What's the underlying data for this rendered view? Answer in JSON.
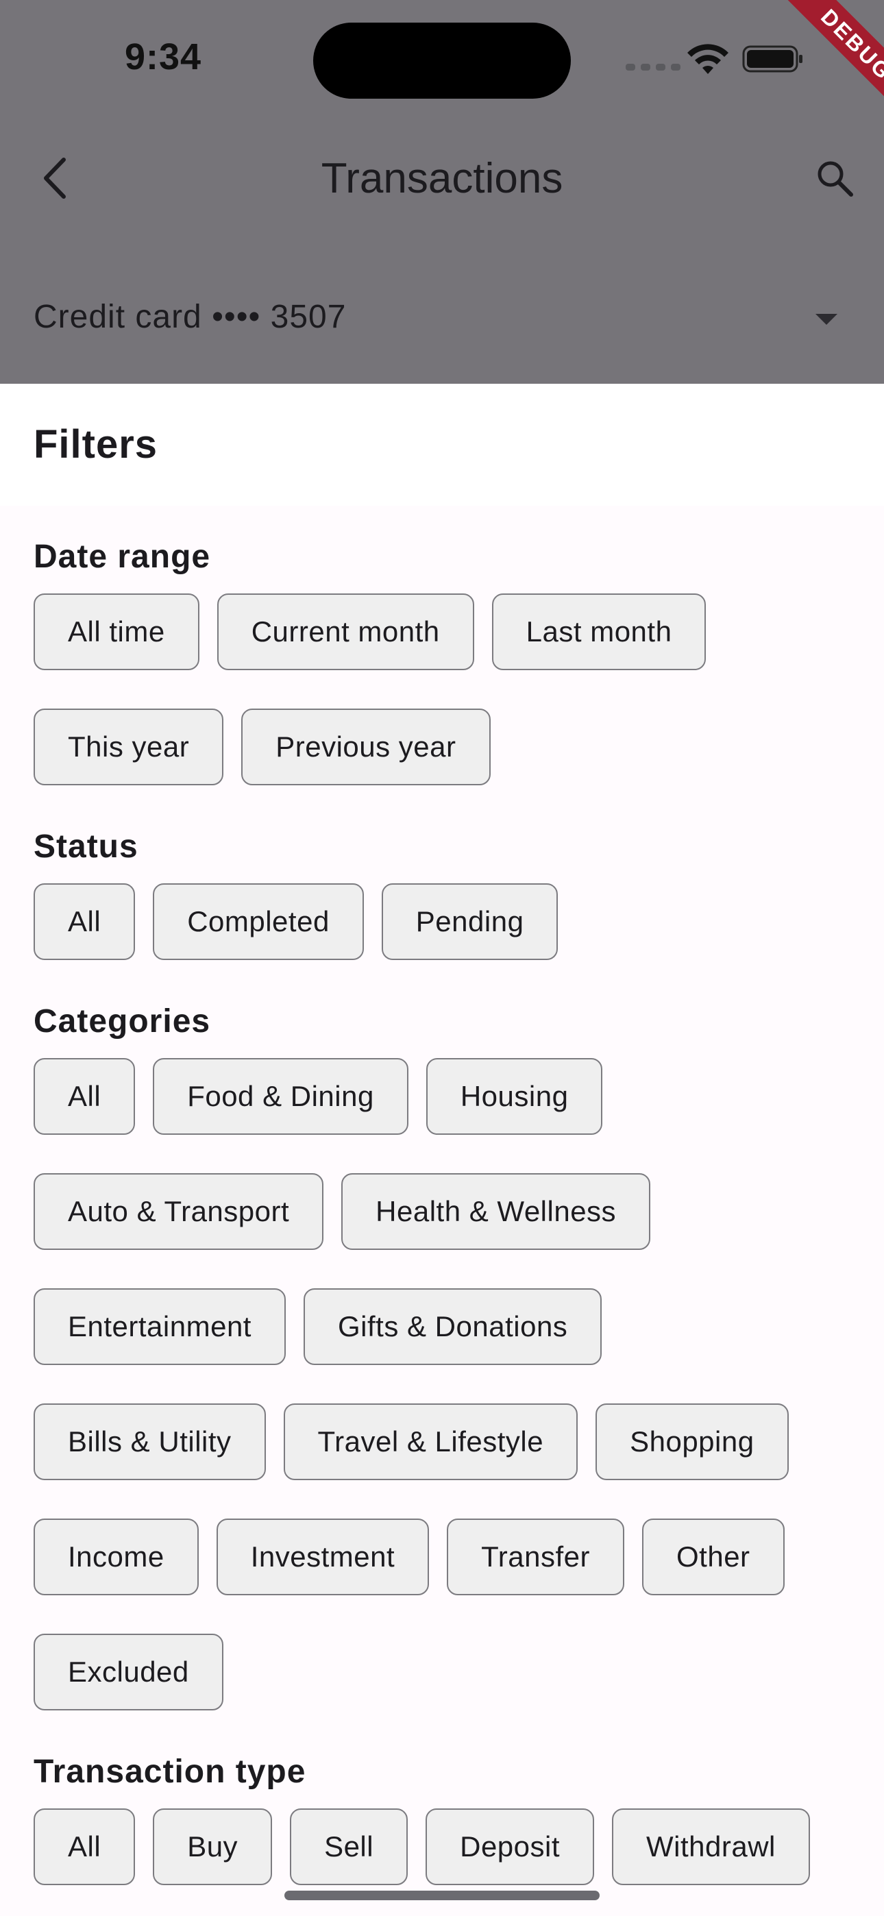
{
  "status_bar": {
    "time": "9:34",
    "debug_label": "DEBUG"
  },
  "app_bar": {
    "title": "Transactions",
    "back_icon": "chevron-left-icon",
    "search_icon": "search-icon"
  },
  "account_selector": {
    "label": "Credit card •••• 3507",
    "icon": "dropdown-arrow-icon"
  },
  "filters": {
    "title": "Filters",
    "date_range": {
      "title": "Date range",
      "rows": [
        [
          "All time",
          "Current month",
          "Last month"
        ],
        [
          "This year",
          "Previous year"
        ]
      ]
    },
    "status": {
      "title": "Status",
      "rows": [
        [
          "All",
          "Completed",
          "Pending"
        ]
      ]
    },
    "categories": {
      "title": "Categories",
      "rows": [
        [
          "All",
          "Food & Dining",
          "Housing"
        ],
        [
          "Auto & Transport",
          "Health & Wellness"
        ],
        [
          "Entertainment",
          "Gifts & Donations"
        ],
        [
          "Bills & Utility",
          "Travel & Lifestyle",
          "Shopping"
        ],
        [
          "Income",
          "Investment",
          "Transfer",
          "Other"
        ],
        [
          "Excluded"
        ]
      ]
    },
    "transaction_type": {
      "title": "Transaction type",
      "rows": [
        [
          "All",
          "Buy",
          "Sell",
          "Deposit",
          "Withdrawl"
        ]
      ]
    }
  },
  "colors": {
    "scrim": "#767479",
    "sheet_bg": "#fffbfe",
    "chip_bg": "#efefef",
    "chip_border": "#7c7b80",
    "debug_ribbon": "#a31d2e"
  }
}
